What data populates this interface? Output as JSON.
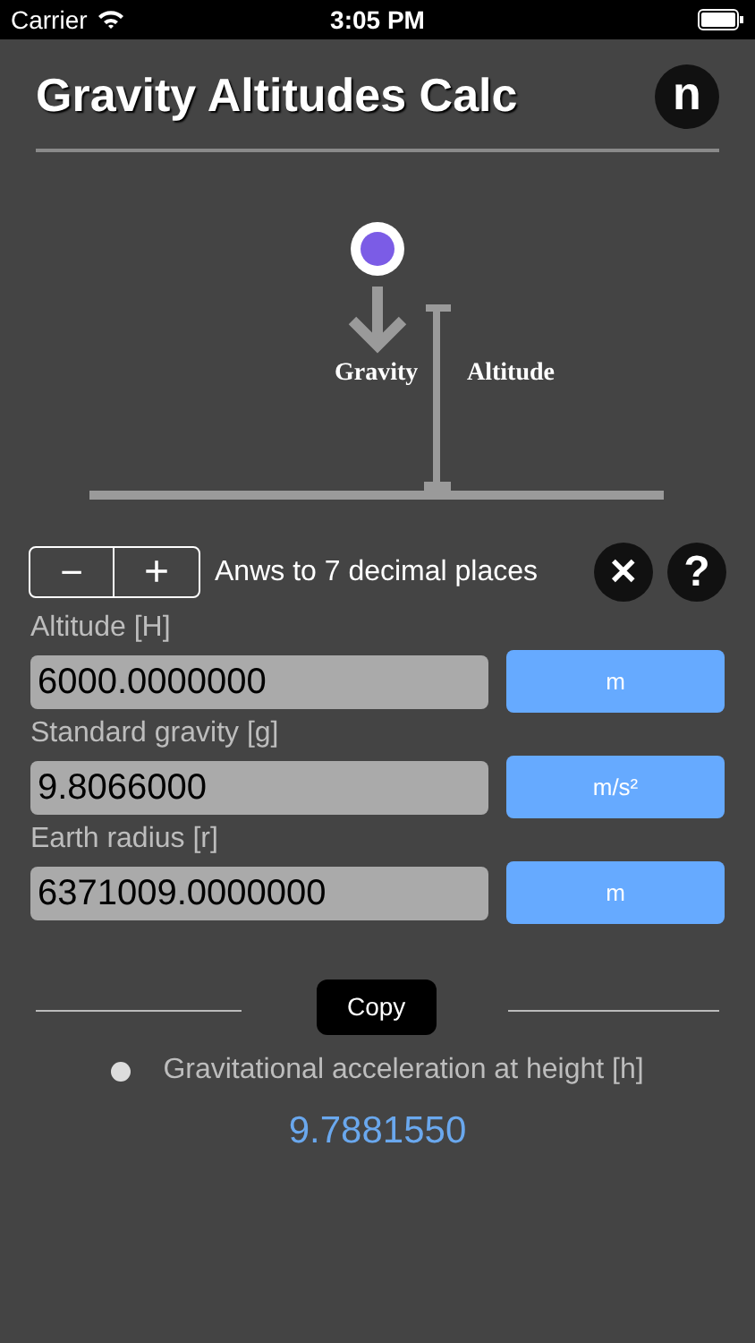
{
  "status_bar": {
    "carrier": "Carrier",
    "time": "3:05 PM"
  },
  "header": {
    "title": "Gravity Altitudes Calc",
    "badge": "n"
  },
  "diagram": {
    "gravity_label": "Gravity",
    "altitude_label": "Altitude"
  },
  "precision": {
    "minus": "−",
    "plus": "+",
    "text": "Anws to 7 decimal places",
    "clear": "✕",
    "help": "?"
  },
  "fields": [
    {
      "label": "Altitude [H]",
      "value": "6000.0000000",
      "unit": "m"
    },
    {
      "label": "Standard gravity [g]",
      "value": "9.8066000",
      "unit": "m/s²"
    },
    {
      "label": "Earth radius [r]",
      "value": "6371009.0000000",
      "unit": "m"
    }
  ],
  "result": {
    "tooltip": "Copy",
    "label": "Gravitational acceleration at height [h]",
    "value": "9.7881550"
  }
}
